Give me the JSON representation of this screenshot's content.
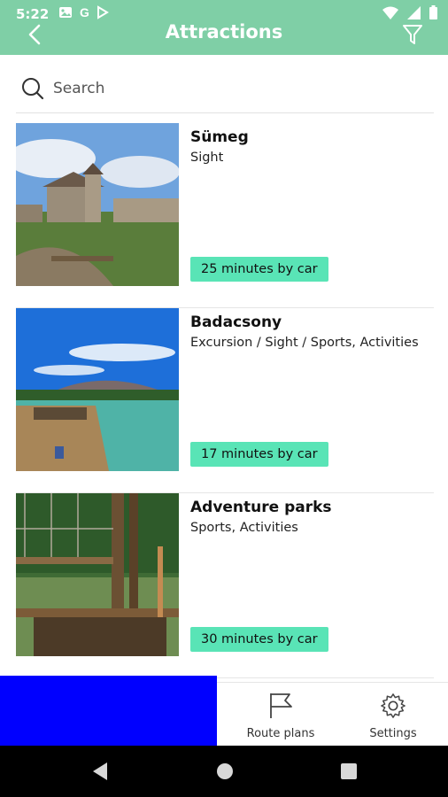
{
  "status_bar": {
    "time": "5:22",
    "left_icons": [
      "photo-icon",
      "google-icon",
      "play-icon"
    ],
    "right_icons": [
      "wifi-icon",
      "signal-icon",
      "battery-icon"
    ]
  },
  "header": {
    "title": "Attractions",
    "back_icon": "chevron-left-icon",
    "filter_icon": "filter-icon",
    "background": "#7fcfa6"
  },
  "search": {
    "placeholder": "Search",
    "icon": "search-icon"
  },
  "attractions": [
    {
      "name": "Sümeg",
      "category": "Sight",
      "travel": "25 minutes by car"
    },
    {
      "name": "Badacsony",
      "category": "Excursion / Sight / Sports, Activities",
      "travel": "17 minutes by car"
    },
    {
      "name": "Adventure parks",
      "category": "Sports, Activities",
      "travel": "30 minutes by car"
    }
  ],
  "bottom_nav": {
    "items": [
      {
        "label": "Route plans",
        "icon": "flag-icon"
      },
      {
        "label": "Settings",
        "icon": "gear-icon"
      }
    ],
    "ad_color": "#0000ff"
  },
  "system_nav": {
    "buttons": [
      "back-triangle-icon",
      "home-circle-icon",
      "recents-square-icon"
    ]
  },
  "colors": {
    "accent": "#7fcfa6",
    "travel_badge": "#59e4b6"
  }
}
